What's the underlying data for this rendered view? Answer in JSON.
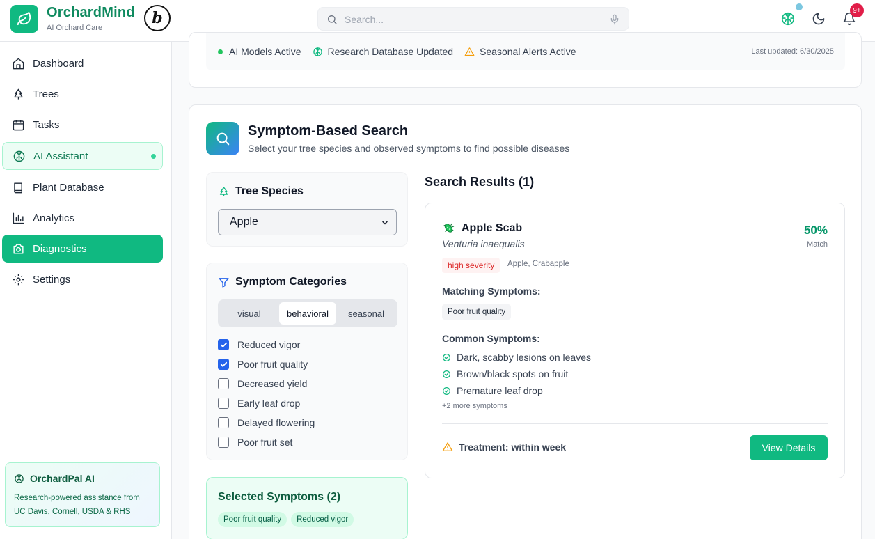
{
  "app": {
    "name": "OrchardMind",
    "subtitle": "AI Orchard Care",
    "badge_letter": "b"
  },
  "search": {
    "placeholder": "Search..."
  },
  "notifications": {
    "count": "9+"
  },
  "sidebar": {
    "items": [
      {
        "label": "Dashboard",
        "icon": "home-icon"
      },
      {
        "label": "Trees",
        "icon": "tree-icon"
      },
      {
        "label": "Tasks",
        "icon": "calendar-icon"
      },
      {
        "label": "AI Assistant",
        "icon": "brain-icon"
      },
      {
        "label": "Plant Database",
        "icon": "book-icon"
      },
      {
        "label": "Analytics",
        "icon": "bar-chart-icon"
      },
      {
        "label": "Diagnostics",
        "icon": "camera-icon"
      },
      {
        "label": "Settings",
        "icon": "gear-icon"
      }
    ],
    "active": "Diagnostics",
    "pal": {
      "title": "OrchardPal AI",
      "text": "Research-powered assistance from UC Davis, Cornell, USDA & RHS"
    }
  },
  "status": {
    "models": "AI Models Active",
    "research": "Research Database Updated",
    "alerts": "Seasonal Alerts Active",
    "last_updated": "Last updated: 6/30/2025"
  },
  "symptom_search": {
    "title": "Symptom-Based Search",
    "subtitle": "Select your tree species and observed symptoms to find possible diseases",
    "species_label": "Tree Species",
    "species_value": "Apple",
    "categories_label": "Symptom Categories",
    "tabs": [
      "visual",
      "behavioral",
      "seasonal"
    ],
    "active_tab": "behavioral",
    "symptoms": [
      {
        "label": "Reduced vigor",
        "checked": true
      },
      {
        "label": "Poor fruit quality",
        "checked": true
      },
      {
        "label": "Decreased yield",
        "checked": false
      },
      {
        "label": "Early leaf drop",
        "checked": false
      },
      {
        "label": "Delayed flowering",
        "checked": false
      },
      {
        "label": "Poor fruit set",
        "checked": false
      }
    ],
    "selected_title": "Selected Symptoms (2)",
    "selected": [
      "Poor fruit quality",
      "Reduced vigor"
    ]
  },
  "results": {
    "title": "Search Results (1)",
    "items": [
      {
        "name": "Apple Scab",
        "scientific": "Venturia inaequalis",
        "severity": "high severity",
        "hosts": "Apple, Crabapple",
        "match": "50%",
        "match_label": "Match",
        "matching_label": "Matching Symptoms:",
        "matching": [
          "Poor fruit quality"
        ],
        "common_label": "Common Symptoms:",
        "common": [
          "Dark, scabby lesions on leaves",
          "Brown/black spots on fruit",
          "Premature leaf drop"
        ],
        "more": "+2 more symptoms",
        "treatment": "Treatment: within week",
        "action": "View Details"
      }
    ]
  },
  "colors": {
    "accent": "#10b981",
    "brand_text": "#0f8a5f",
    "severity": "#dc2626",
    "checkbox": "#2563eb"
  }
}
